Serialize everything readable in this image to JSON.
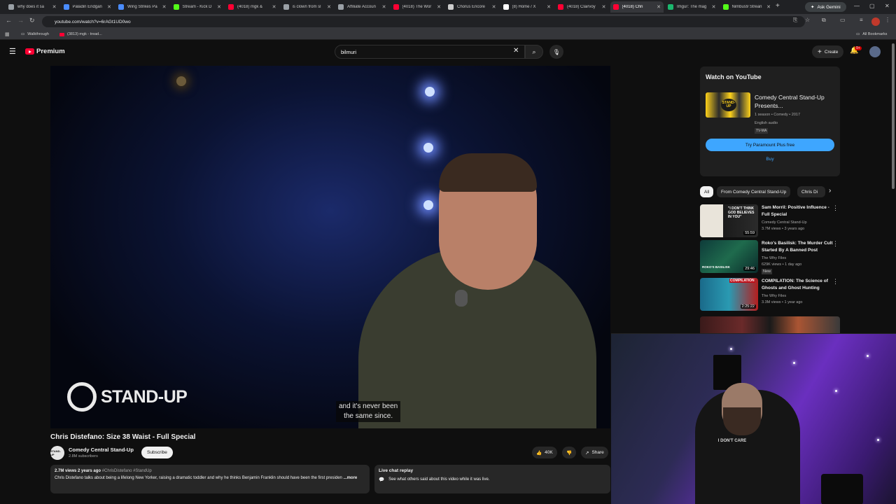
{
  "browser": {
    "tabs": [
      {
        "label": "why does it sa",
        "color": "#9aa0a6"
      },
      {
        "label": "Paladin Endgan",
        "color": "#4a8cff"
      },
      {
        "label": "Wing Strikes Pa",
        "color": "#4a8cff"
      },
      {
        "label": "Stream - Kick D",
        "color": "#53fc18"
      },
      {
        "label": "(4018) mgk & ",
        "color": "#ff0033"
      },
      {
        "label": "is clown from sl",
        "color": "#9aa0a6"
      },
      {
        "label": "Affiliate Accoun",
        "color": "#9aa0a6"
      },
      {
        "label": "(4018) The Wor",
        "color": "#ff0033"
      },
      {
        "label": "Chorus Encore",
        "color": "#cccccc"
      },
      {
        "label": "(8) Home / X",
        "color": "#ffffff"
      },
      {
        "label": "(4018) Clairvoy",
        "color": "#ff0033"
      },
      {
        "label": "(4018) Chri",
        "color": "#ff0033"
      },
      {
        "label": "Imgur: The mag",
        "color": "#1bb76e"
      },
      {
        "label": "Nimbus9 Strean",
        "color": "#53fc18"
      }
    ],
    "ask_gemini": "Ask Gemini",
    "url": "youtube.com/watch?v=6rAGt1UD0wo",
    "bookmarks": [
      {
        "label": "Walkthrough"
      },
      {
        "label": "(3813) mgk - tread..."
      }
    ],
    "all_bookmarks": "All Bookmarks"
  },
  "header": {
    "logo_text": "Premium",
    "search_value": "bilmuri",
    "create_label": "Create",
    "notif_badge": "9+"
  },
  "video": {
    "overlay_brand": "STAND-UP",
    "subtitle_line1": "and it's never been",
    "subtitle_line2": "the same since."
  },
  "below": {
    "title": "Chris Distefano: Size 38 Waist - Full Special",
    "channel_name": "Comedy Central Stand-Up",
    "channel_subs": "2.8M subscribers",
    "channel_avatar": "STAND-UP",
    "subscribe_label": "Subscribe",
    "like_count": "40K",
    "share_label": "Share",
    "desc_meta": "2.7M views  2 years ago",
    "desc_tags": "#ChrisDistefano #StandUp",
    "desc_text": "Chris Distefano talks about being a lifelong New Yorker, raising a dramatic toddler and why he thinks Benjamin Franklin should have been the first presiden",
    "desc_more": "...more",
    "live_title": "Live chat replay",
    "live_text": "See what others said about this video while it was live."
  },
  "sidebar": {
    "watch_heading": "Watch on YouTube",
    "show_title": "Comedy Central Stand-Up Presents...",
    "show_meta": "1 season • Comedy • 2017",
    "show_audio": "English audio",
    "show_rating": "TV-MA",
    "poster_text": "STAND-UP",
    "try_label": "Try Paramount Plus free",
    "buy_label": "Buy",
    "chips": [
      "All",
      "From Comedy Central Stand-Up",
      "Chris Di"
    ],
    "recs": [
      {
        "title": "Sam Morril: Positive Influence - Full Special",
        "channel": "Comedy Central Stand-Up",
        "meta": "3.7M views • 3 years ago",
        "badge": "",
        "duration": "55:59",
        "thumb_text": "\"I DON'T THINK GOD BELIEVES IN YOU\""
      },
      {
        "title": "Roko's Basilisk: The Murder Cult Started By A Banned Post",
        "channel": "The Why Files",
        "meta": "629K views • 1 day ago",
        "badge": "New",
        "duration": "29:46",
        "thumb_text": "ROKO'S BASILISK"
      },
      {
        "title": "COMPILATION: The Science of Ghosts and Ghost Hunting",
        "channel": "The Why Files",
        "meta": "3.3M views • 1 year ago",
        "badge": "",
        "duration": "2:25:22",
        "thumb_text": "COMPILATION"
      }
    ]
  },
  "webcam": {
    "shirt_text": "I DON'T CARE"
  }
}
